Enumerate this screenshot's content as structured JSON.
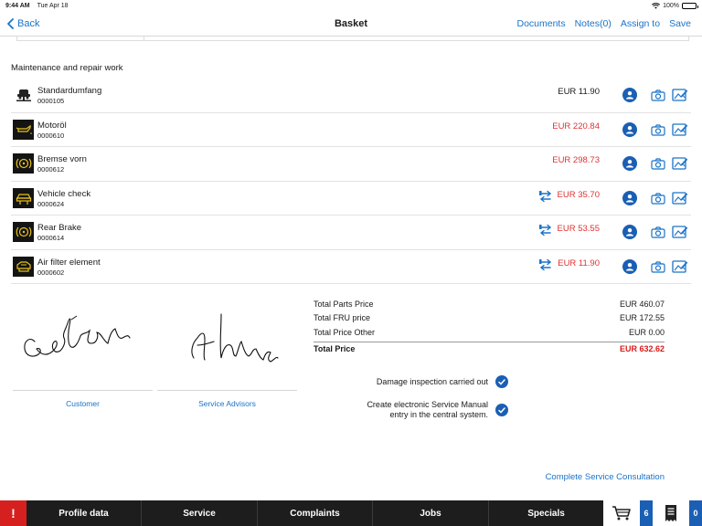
{
  "status_bar": {
    "time": "9:44 AM",
    "date": "Tue Apr 18",
    "battery": "100%",
    "battery_level": 1.0
  },
  "nav": {
    "back_label": "Back",
    "title": "Basket",
    "actions": [
      "Documents",
      "Notes(0)",
      "Assign to",
      "Save"
    ]
  },
  "section_title": "Maintenance and repair work",
  "items": [
    {
      "name": "Standardumfang",
      "code": "0000105",
      "price": "EUR 11.90",
      "price_color": "#1a1a1a",
      "icon": "car-lift-icon",
      "swap": false
    },
    {
      "name": "Motoröl",
      "code": "0000610",
      "price": "EUR 220.84",
      "price_color": "#e03131",
      "icon": "oil-can-icon",
      "swap": false
    },
    {
      "name": "Bremse vorn",
      "code": "0000612",
      "price": "EUR 298.73",
      "price_color": "#e03131",
      "icon": "brake-icon",
      "swap": false
    },
    {
      "name": "Vehicle check",
      "code": "0000624",
      "price": "EUR 35.70",
      "price_color": "#e03131",
      "icon": "vehicle-check-icon",
      "swap": true
    },
    {
      "name": "Rear Brake",
      "code": "0000614",
      "price": "EUR 53.55",
      "price_color": "#e03131",
      "icon": "brake-icon",
      "swap": true
    },
    {
      "name": "Air filter element",
      "code": "0000602",
      "price": "EUR 11.90",
      "price_color": "#e03131",
      "icon": "air-filter-icon",
      "swap": true
    }
  ],
  "signatures": {
    "customer_label": "Customer",
    "advisor_label": "Service Advisors"
  },
  "totals": {
    "parts_label": "Total Parts Price",
    "parts_value": "EUR 460.07",
    "fru_label": "Total FRU price",
    "fru_value": "EUR 172.55",
    "other_label": "Total Price Other",
    "other_value": "EUR 0.00",
    "total_label": "Total Price",
    "total_value": "EUR 632.62"
  },
  "checks": {
    "damage_label": "Damage inspection carried out",
    "manual_label_line1": "Create electronic Service Manual",
    "manual_label_line2": "entry in the central system."
  },
  "complete_link": "Complete Service Consultation",
  "tab_bar": {
    "alert": "!",
    "tabs": [
      "Profile data",
      "Service",
      "Complaints",
      "Jobs",
      "Specials"
    ],
    "cart_count": "6",
    "docs_count": "0"
  },
  "colors": {
    "accent": "#1a73c8",
    "button_blue": "#1a5fb4",
    "price_red": "#e03131",
    "tab_bar": "#1d1d1d",
    "alert_red": "#d62020"
  }
}
